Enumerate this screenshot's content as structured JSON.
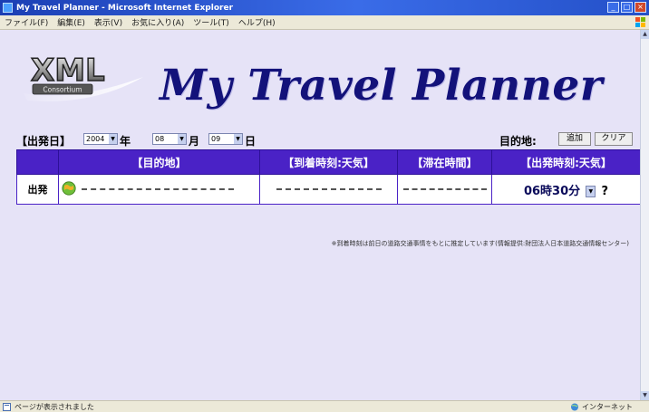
{
  "window": {
    "title": "My Travel Planner - Microsoft Internet Explorer",
    "controls": {
      "minimize": "_",
      "maximize": "□",
      "close": "×"
    }
  },
  "menu": [
    "ファイル(F)",
    "編集(E)",
    "表示(V)",
    "お気に入り(A)",
    "ツール(T)",
    "ヘルプ(H)"
  ],
  "banner": {
    "logo_text": "XML",
    "logo_subtext": "Consortium",
    "title": "My Travel Planner"
  },
  "form": {
    "departure_label": "【出発日】",
    "year_value": "2004",
    "year_unit": "年",
    "month_value": "08",
    "month_unit": "月",
    "day_value": "09",
    "day_unit": "日",
    "destination_label": "目的地:",
    "add_button": "追加",
    "clear_button": "クリア"
  },
  "table": {
    "headers": [
      "",
      "【目的地】",
      "【到着時刻:天気】",
      "【滞在時間】",
      "【出発時刻:天気】"
    ],
    "rows": [
      {
        "label": "出発",
        "destination": "",
        "arrival": "",
        "stay": "",
        "departure_time": "06時30分",
        "departure_weather": "?"
      }
    ]
  },
  "note": "※到着時刻は前日の道路交通事情をもとに推定しています(情報提供:財団法人日本道路交通情報センター)",
  "status": {
    "text": "ページが表示されました",
    "zone": "インターネット"
  },
  "colors": {
    "header_bg": "#4a22c6",
    "page_bg": "#e6e3f7",
    "title_color": "#13127a"
  }
}
